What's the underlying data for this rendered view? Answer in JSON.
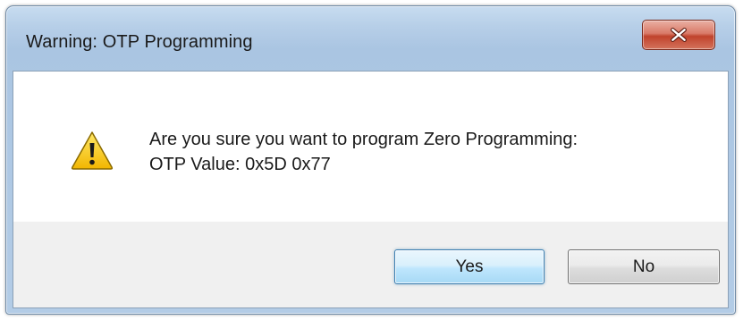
{
  "window": {
    "title": "Warning: OTP Programming",
    "close_icon": "close-icon"
  },
  "message": {
    "icon": "warning-icon",
    "line1": "Are you sure you want to program Zero Programming:",
    "line2": "OTP Value: 0x5D 0x77"
  },
  "buttons": {
    "yes_label": "Yes",
    "no_label": "No"
  },
  "colors": {
    "title_bar": "#b7cfe8",
    "close_button": "#c7503a",
    "warning_yellow": "#f5c400",
    "default_button_border": "#3c7fb1"
  }
}
